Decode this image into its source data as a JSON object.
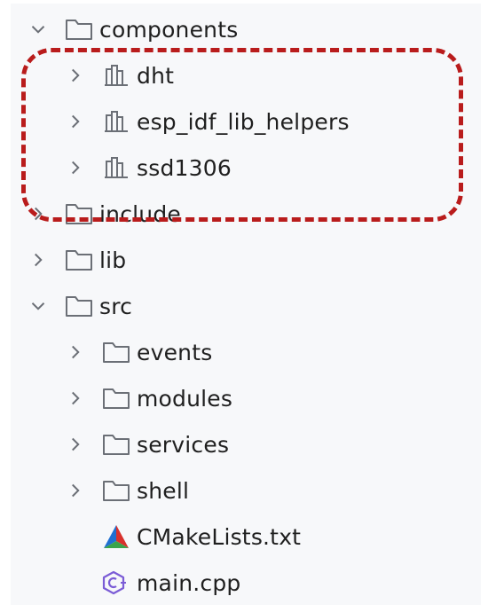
{
  "tree": {
    "items": [
      {
        "label": "components",
        "icon": "folder-icon",
        "expanded": true
      },
      {
        "label": "dht",
        "icon": "library-icon",
        "expanded": false
      },
      {
        "label": "esp_idf_lib_helpers",
        "icon": "library-icon",
        "expanded": false
      },
      {
        "label": "ssd1306",
        "icon": "library-icon",
        "expanded": false
      },
      {
        "label": "include",
        "icon": "folder-icon",
        "expanded": false
      },
      {
        "label": "lib",
        "icon": "folder-icon",
        "expanded": false
      },
      {
        "label": "src",
        "icon": "folder-icon",
        "expanded": true
      },
      {
        "label": "events",
        "icon": "folder-icon",
        "expanded": false
      },
      {
        "label": "modules",
        "icon": "folder-icon",
        "expanded": false
      },
      {
        "label": "services",
        "icon": "folder-icon",
        "expanded": false
      },
      {
        "label": "shell",
        "icon": "folder-icon",
        "expanded": false
      },
      {
        "label": "CMakeLists.txt",
        "icon": "cmake-icon"
      },
      {
        "label": "main.cpp",
        "icon": "cpp-file-icon"
      }
    ]
  },
  "colors": {
    "highlight_border": "#b91c1c",
    "panel_background": "#f7f8fa",
    "icon_stroke": "#6b6f76"
  }
}
